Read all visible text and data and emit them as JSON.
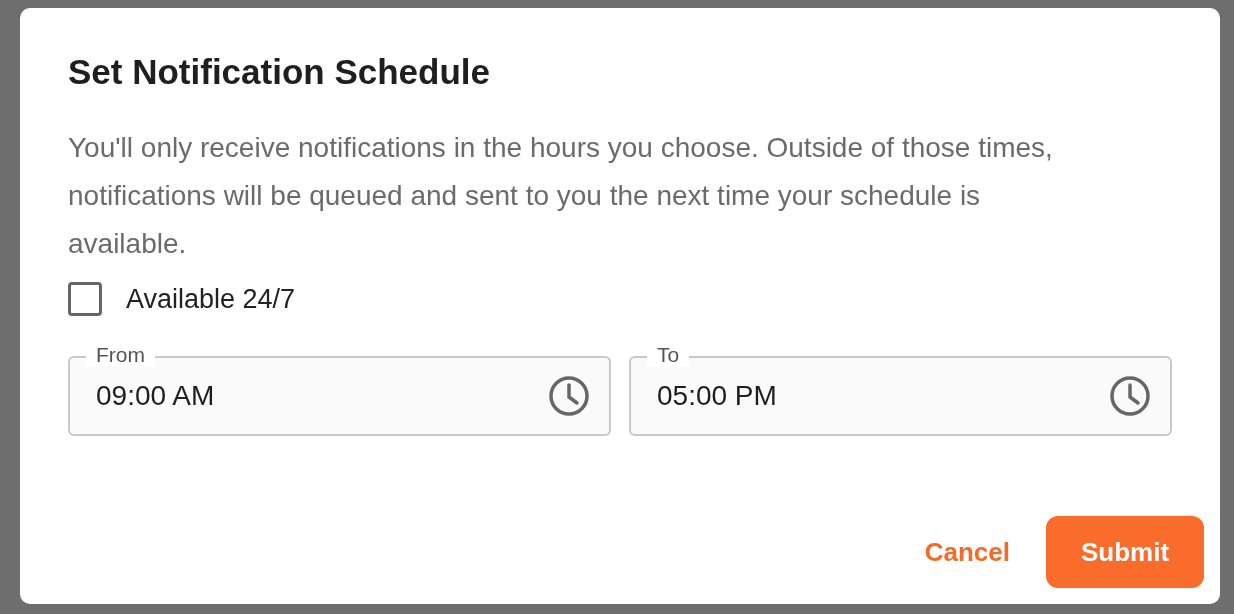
{
  "dialog": {
    "title": "Set Notification Schedule",
    "description": "You'll only receive notifications in the hours you choose. Outside of those times, notifications will be queued and sent to you the next time your schedule is available.",
    "checkbox": {
      "label": "Available 24/7",
      "checked": false
    },
    "fields": [
      {
        "label": "From",
        "value": "09:00 AM"
      },
      {
        "label": "To",
        "value": "05:00 PM"
      }
    ],
    "buttons": [
      {
        "label": "Cancel",
        "kind": "text"
      },
      {
        "label": "Submit",
        "kind": "primary"
      }
    ]
  }
}
